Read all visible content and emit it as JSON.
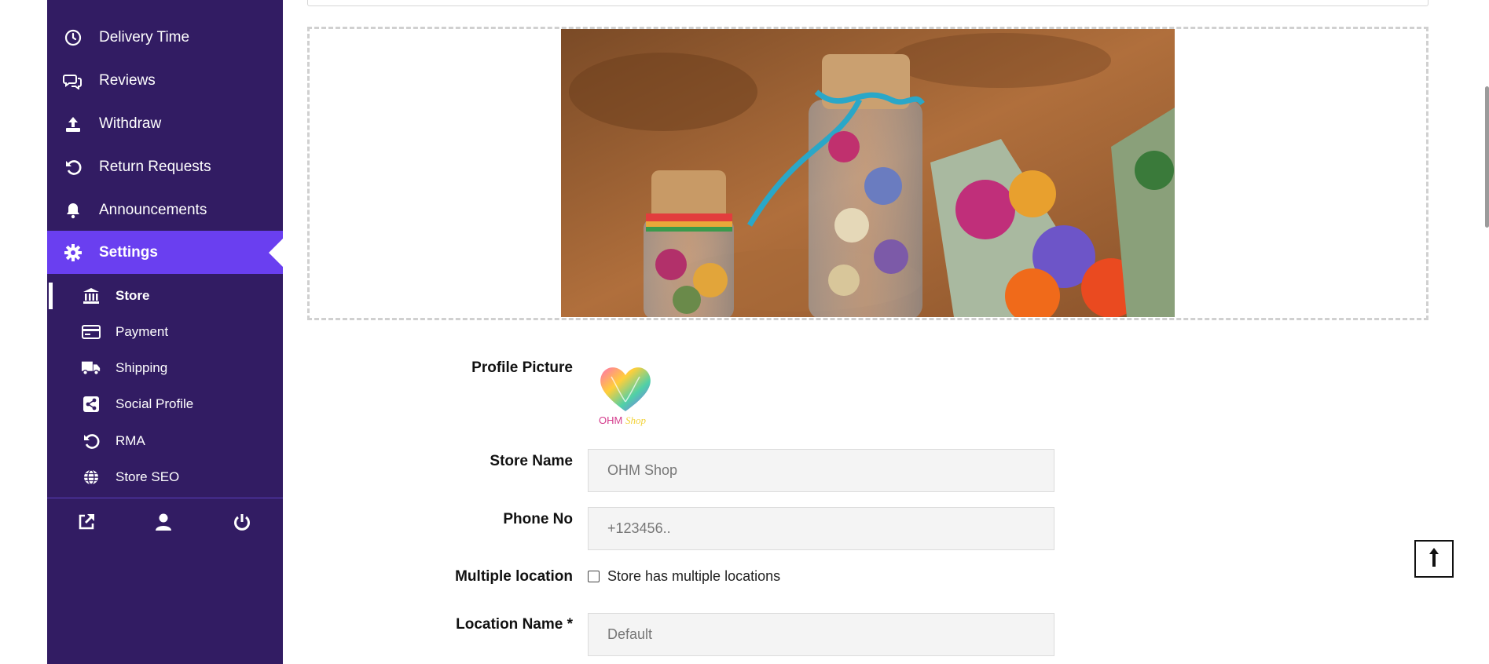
{
  "sidebar": {
    "items": [
      {
        "label": "Delivery Time",
        "icon": "clock-icon"
      },
      {
        "label": "Reviews",
        "icon": "comments-icon"
      },
      {
        "label": "Withdraw",
        "icon": "upload-icon"
      },
      {
        "label": "Return Requests",
        "icon": "undo-icon"
      },
      {
        "label": "Announcements",
        "icon": "bell-icon"
      },
      {
        "label": "Settings",
        "icon": "gear-icon",
        "active": true
      }
    ],
    "settings_sub": [
      {
        "label": "Store",
        "icon": "bank-icon",
        "current": true
      },
      {
        "label": "Payment",
        "icon": "credit-card-icon"
      },
      {
        "label": "Shipping",
        "icon": "truck-icon"
      },
      {
        "label": "Social Profile",
        "icon": "share-icon"
      },
      {
        "label": "RMA",
        "icon": "undo-icon"
      },
      {
        "label": "Store SEO",
        "icon": "globe-icon"
      }
    ],
    "footer": [
      "external-link-icon",
      "user-icon",
      "power-icon"
    ],
    "colors": {
      "bg": "#321c63",
      "active": "#6a3ff0"
    }
  },
  "form": {
    "profile_picture_label": "Profile Picture",
    "store_name_label": "Store Name",
    "store_name_value": "OHM Shop",
    "phone_label": "Phone No",
    "phone_placeholder": "+123456..",
    "multiple_location_label": "Multiple location",
    "multiple_location_checkbox": "Store has multiple locations",
    "multiple_location_checked": false,
    "location_name_label": "Location Name *",
    "location_name_value": "Default"
  },
  "logo": {
    "text_1": "OHM",
    "text_2": "Shop"
  },
  "back_to_top": "↑"
}
